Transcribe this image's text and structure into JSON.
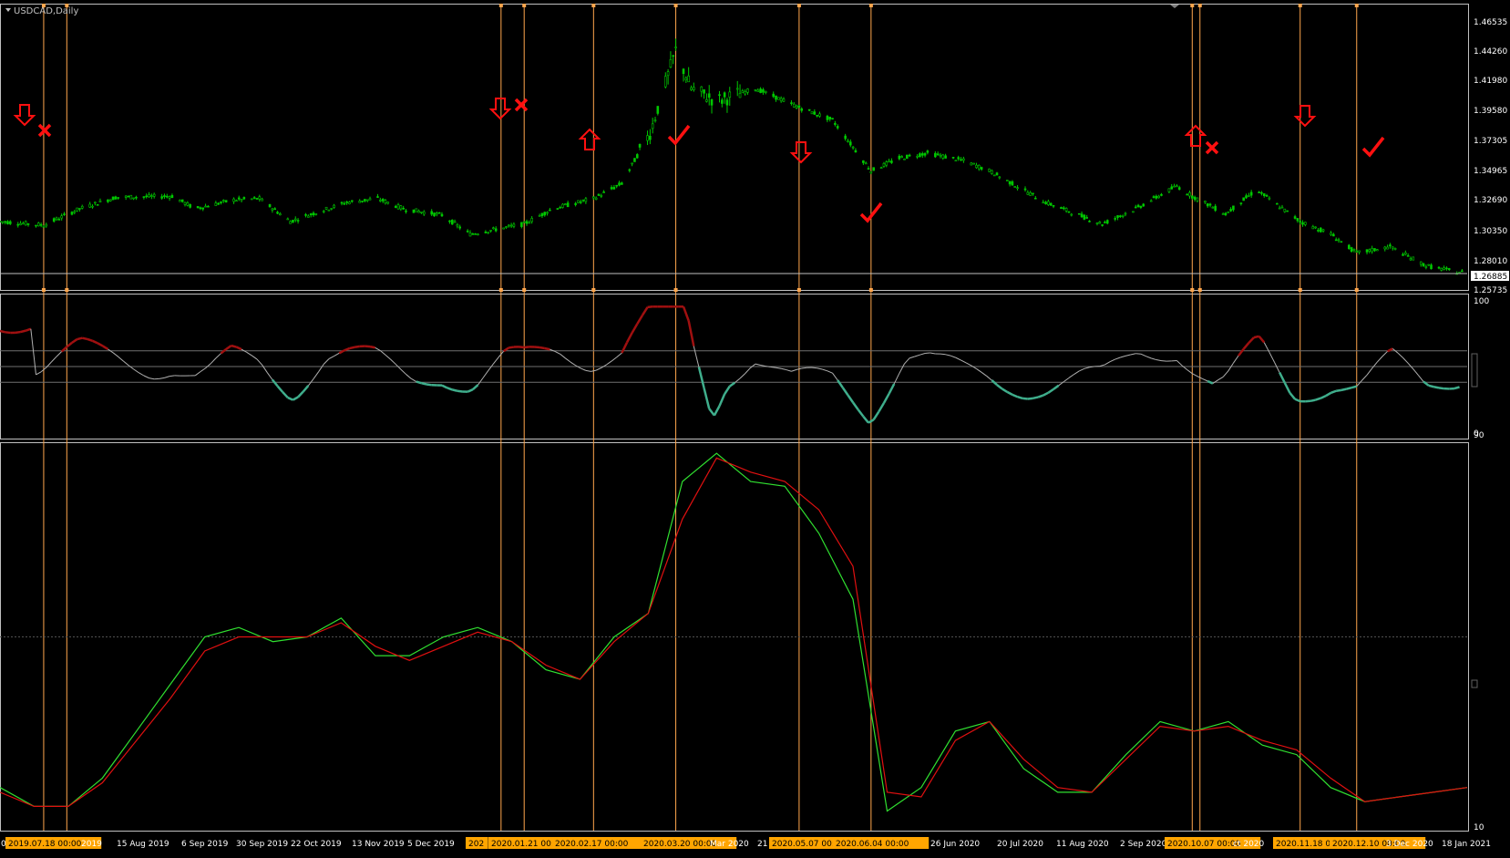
{
  "window": {
    "symbol_label": "USDCAD,Daily"
  },
  "colors": {
    "background": "#000000",
    "frame": "#c0c0c0",
    "bull_candle": "#00c800",
    "bear_candle": "#00c800",
    "vline": "#ffa64d",
    "marker": "#ff1010",
    "osc_neutral": "#b0b0b0",
    "osc_high": "#a01010",
    "osc_low": "#3fae8c",
    "ind_green": "#30e030",
    "ind_red": "#e01010",
    "date_highlight_bg": "#ffa500"
  },
  "price_axis": {
    "ticks": [
      "1.46535",
      "1.44260",
      "1.41980",
      "1.39580",
      "1.37305",
      "1.34965",
      "1.32690",
      "1.30350",
      "1.28010",
      "1.25735"
    ],
    "current_price": "1.26885"
  },
  "oscillator_axis": {
    "ticks": [
      "100",
      "0"
    ]
  },
  "indicator_axis": {
    "ticks": [
      "90",
      "10"
    ]
  },
  "chart_data": {
    "type": "candlestick",
    "symbol": "USDCAD",
    "timeframe": "Daily",
    "price_range": [
      1.25735,
      1.46535
    ],
    "price_series": [
      [
        "2019-07-01",
        1.31
      ],
      [
        "2019-07-18",
        1.307
      ],
      [
        "2019-08-01",
        1.32
      ],
      [
        "2019-08-15",
        1.329
      ],
      [
        "2019-09-06",
        1.33
      ],
      [
        "2019-09-15",
        1.32
      ],
      [
        "2019-09-30",
        1.327
      ],
      [
        "2019-10-10",
        1.328
      ],
      [
        "2019-10-22",
        1.31
      ],
      [
        "2019-11-01",
        1.317
      ],
      [
        "2019-11-13",
        1.325
      ],
      [
        "2019-11-25",
        1.328
      ],
      [
        "2019-12-05",
        1.32
      ],
      [
        "2019-12-20",
        1.315
      ],
      [
        "2019-12-31",
        1.3
      ],
      [
        "2020-01-21",
        1.308
      ],
      [
        "2020-02-01",
        1.32
      ],
      [
        "2020-02-17",
        1.328
      ],
      [
        "2020-02-28",
        1.34
      ],
      [
        "2020-03-10",
        1.38
      ],
      [
        "2020-03-20",
        1.445
      ],
      [
        "2020-03-26",
        1.415
      ],
      [
        "2020-04-05",
        1.405
      ],
      [
        "2020-04-20",
        1.415
      ],
      [
        "2020-05-07",
        1.4
      ],
      [
        "2020-05-20",
        1.39
      ],
      [
        "2020-06-04",
        1.35
      ],
      [
        "2020-06-15",
        1.36
      ],
      [
        "2020-06-26",
        1.364
      ],
      [
        "2020-07-10",
        1.358
      ],
      [
        "2020-07-20",
        1.35
      ],
      [
        "2020-08-11",
        1.325
      ],
      [
        "2020-09-02",
        1.308
      ],
      [
        "2020-09-15",
        1.32
      ],
      [
        "2020-10-01",
        1.338
      ],
      [
        "2020-10-07",
        1.33
      ],
      [
        "2020-10-20",
        1.316
      ],
      [
        "2020-11-01",
        1.335
      ],
      [
        "2020-11-18",
        1.31
      ],
      [
        "2020-11-30",
        1.3
      ],
      [
        "2020-12-10",
        1.285
      ],
      [
        "2020-12-23",
        1.29
      ],
      [
        "2021-01-06",
        1.275
      ],
      [
        "2021-01-18",
        1.27
      ]
    ],
    "time_labels": [
      "01",
      "2019.07.18 00:00",
      "2019",
      "15 Aug 2019",
      "6 Sep 2019",
      "30 Sep 2019",
      "22 Oct 2019",
      "13 Nov 2019",
      "5 Dec 2019",
      "202",
      "2020.01.21 00:00",
      "2020.02.17 00:00",
      "2020.03.20 00:00",
      "Mar 2020",
      "21",
      "2020.05.07 00:00",
      "2020.06.04 00:00",
      "26 Jun 2020",
      "20 Jul 2020",
      "11 Aug 2020",
      "2 Sep 2020",
      "2020.10.07 00:00",
      "ct 2020",
      "2020.11.18 00:00",
      "2020.12.10 00:00",
      "3 Dec 2020",
      "18 Jan 2021"
    ],
    "highlighted_time_labels": [
      "2019.07.18 00:00",
      "202",
      "2020.01.21 00:00",
      "2020.02.17 00:00",
      "2020.03.20 00:00",
      "2020.05.07 00:00",
      "2020.06.04 00:00",
      "2020.10.07 00:00",
      "2020.11.18 00:00",
      "2020.12.10 00:00"
    ],
    "signal_markers": [
      {
        "type": "arrow-down",
        "result": "x"
      },
      {
        "type": "arrow-down",
        "result": "x"
      },
      {
        "type": "arrow-up",
        "result": "check"
      },
      {
        "type": "arrow-down",
        "result": "check"
      },
      {
        "type": "arrow-up",
        "result": "x"
      },
      {
        "type": "arrow-down",
        "result": "check"
      }
    ],
    "oscillator": {
      "range": [
        0,
        100
      ],
      "levels": [
        50,
        61.8,
        38.2
      ]
    },
    "indicator": {
      "range": [
        10,
        90
      ],
      "level": 50,
      "series": [
        {
          "color": "green",
          "values": [
            18,
            14,
            14,
            20,
            30,
            40,
            50,
            52,
            49,
            50,
            54,
            46,
            46,
            50,
            52,
            49,
            43,
            41,
            50,
            55,
            83,
            89,
            83,
            82,
            72,
            58,
            13,
            18,
            30,
            32,
            22,
            17,
            17,
            25,
            32,
            30,
            32,
            27,
            25,
            18,
            15,
            16,
            17,
            18
          ]
        },
        {
          "color": "red",
          "values": [
            17,
            14,
            14,
            19,
            28,
            37,
            47,
            50,
            50,
            50,
            53,
            48,
            45,
            48,
            51,
            49,
            44,
            41,
            49,
            55,
            75,
            88,
            85,
            83,
            77,
            65,
            17,
            16,
            28,
            32,
            24,
            18,
            17,
            24,
            31,
            30,
            31,
            28,
            26,
            20,
            15,
            16,
            17,
            18
          ]
        }
      ]
    }
  }
}
